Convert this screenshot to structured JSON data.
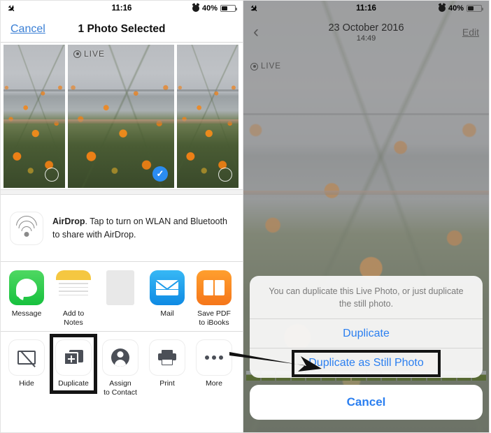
{
  "status_bar": {
    "airplane_icon": "airplane-mode-icon",
    "time": "11:16",
    "alarm_icon": "alarm-clock-icon",
    "battery_percent": "40%",
    "battery_icon": "battery-icon"
  },
  "left_panel": {
    "nav": {
      "cancel_label": "Cancel",
      "title": "1 Photo Selected"
    },
    "thumbnails": [
      {
        "name": "thumbnail-1",
        "selected": false,
        "live": false
      },
      {
        "name": "thumbnail-2",
        "selected": true,
        "live": true,
        "live_label": "LIVE"
      },
      {
        "name": "thumbnail-3",
        "selected": false,
        "live": false
      }
    ],
    "airdrop": {
      "title": "AirDrop",
      "description": ". Tap to turn on WLAN and Bluetooth to share with AirDrop.",
      "icon": "airdrop-icon"
    },
    "apps": [
      {
        "label": "Message",
        "icon": "message-icon"
      },
      {
        "label": "Add to Notes",
        "icon": "notes-icon"
      },
      {
        "label": "",
        "icon": "blank-placeholder-icon"
      },
      {
        "label": "Mail",
        "icon": "mail-icon"
      },
      {
        "label": "Save PDF\nto iBooks",
        "icon": "ibooks-icon"
      }
    ],
    "actions": [
      {
        "label": "Hide",
        "icon": "hide-icon",
        "highlighted": false
      },
      {
        "label": "Duplicate",
        "icon": "duplicate-icon",
        "highlighted": true
      },
      {
        "label": "Assign\nto Contact",
        "icon": "assign-contact-icon",
        "highlighted": false
      },
      {
        "label": "Print",
        "icon": "print-icon",
        "highlighted": false
      },
      {
        "label": "More",
        "icon": "more-icon",
        "highlighted": false
      }
    ]
  },
  "right_panel": {
    "nav": {
      "back_icon": "back-chevron-icon",
      "date": "23 October 2016",
      "time": "14:49",
      "edit_label": "Edit"
    },
    "live_label": "LIVE",
    "action_sheet": {
      "message": "You can duplicate this Live Photo, or just duplicate the still photo.",
      "options": [
        {
          "label": "Duplicate",
          "highlighted": false
        },
        {
          "label": "Duplicate as Still Photo",
          "highlighted": true
        }
      ],
      "cancel_label": "Cancel"
    }
  },
  "annotation": {
    "arrow": "pointer-arrow",
    "highlight_color": "#141414"
  },
  "colors": {
    "accent_blue": "#2b7ff0",
    "link_blue": "#3a7fd5",
    "highlight_black": "#141414"
  }
}
